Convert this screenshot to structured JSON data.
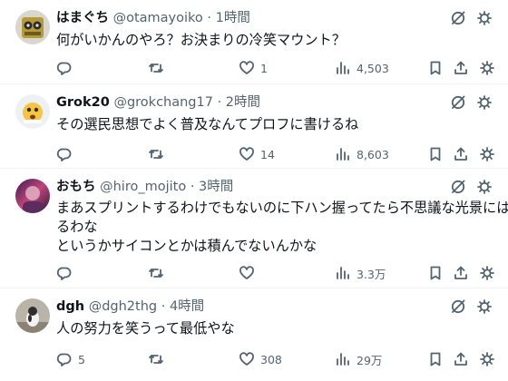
{
  "tweets": [
    {
      "name": "はまぐち",
      "handle": "@otamayoiko",
      "dot": "·",
      "time": "1時間",
      "lines": [
        "何がいかんのやろ？お決まりの冷笑マウント？"
      ],
      "replies": "",
      "retweets": "",
      "likes": "1",
      "views": "4,503"
    },
    {
      "name": "Grok20",
      "handle": "@grokchang17",
      "dot": "·",
      "time": "2時間",
      "lines": [
        "その選民思想でよく普及なんてプロフに書けるね"
      ],
      "replies": "",
      "retweets": "",
      "likes": "14",
      "views": "8,603"
    },
    {
      "name": "おもち",
      "handle": "@hiro_mojito",
      "dot": "·",
      "time": "3時間",
      "lines": [
        "まあスプリントするわけでもないのに下ハン握ってたら不思議な光景にはな",
        "るわな",
        "というかサイコンとかは積んでないんかな"
      ],
      "replies": "",
      "retweets": "",
      "likes": "",
      "views": "3.3万"
    },
    {
      "name": "dgh",
      "handle": "@dgh2thg",
      "dot": "·",
      "time": "4時間",
      "lines": [
        "人の努力を笑うって最低やな"
      ],
      "replies": "5",
      "retweets": "",
      "likes": "308",
      "views": "29万"
    }
  ],
  "colors": {
    "text": "#0f1419",
    "secondary": "#536471",
    "divider": "#eff3f4"
  },
  "icons": {
    "reply": "reply-icon",
    "retweet": "retweet-icon",
    "like": "heart-icon",
    "views": "views-icon",
    "bookmark": "bookmark-icon",
    "share": "share-icon",
    "grok": "grok-icon",
    "more": "more-icon"
  }
}
